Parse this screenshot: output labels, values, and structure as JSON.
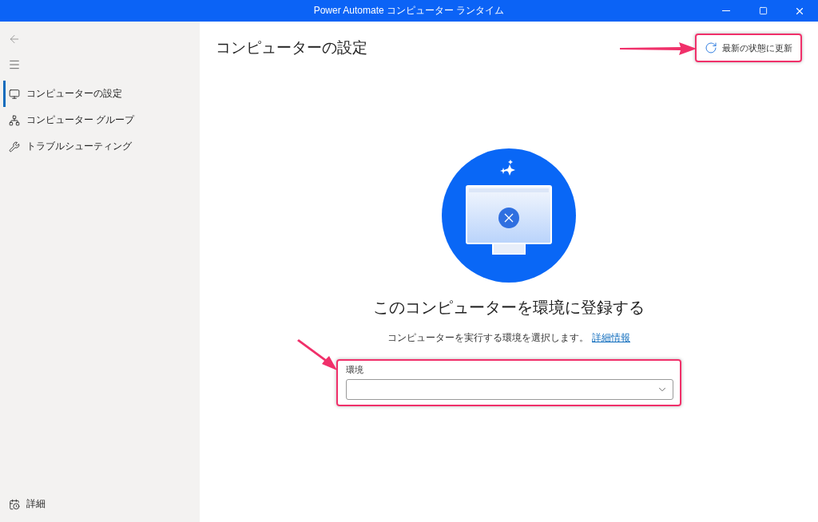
{
  "window": {
    "title": "Power Automate コンピューター ランタイム"
  },
  "sidebar": {
    "items": [
      {
        "label": "コンピューターの設定",
        "selected": true
      },
      {
        "label": "コンピューター グループ",
        "selected": false
      },
      {
        "label": "トラブルシューティング",
        "selected": false
      }
    ],
    "footer": {
      "label": "詳細"
    }
  },
  "page": {
    "title": "コンピューターの設定",
    "refresh_button": "最新の状態に更新"
  },
  "register": {
    "title": "このコンピューターを環境に登録する",
    "description": "コンピューターを実行する環境を選択します。",
    "link": "詳細情報",
    "field_label": "環境"
  }
}
